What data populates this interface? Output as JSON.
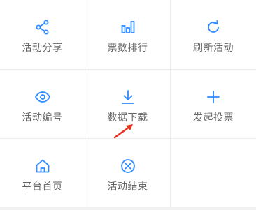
{
  "accent_color": "#2f8bff",
  "annotation_color": "#e8311f",
  "menu": {
    "items": [
      {
        "label": "活动分享",
        "icon": "share-icon"
      },
      {
        "label": "票数排行",
        "icon": "bar-chart-icon"
      },
      {
        "label": "刷新活动",
        "icon": "refresh-icon"
      },
      {
        "label": "活动编号",
        "icon": "eye-icon"
      },
      {
        "label": "数据下载",
        "icon": "download-icon"
      },
      {
        "label": "发起投票",
        "icon": "plus-icon"
      },
      {
        "label": "平台首页",
        "icon": "home-icon"
      },
      {
        "label": "活动结束",
        "icon": "close-circle-icon"
      }
    ]
  },
  "annotation": {
    "icon": "red-arrow-icon",
    "points_to": "数据下载"
  }
}
